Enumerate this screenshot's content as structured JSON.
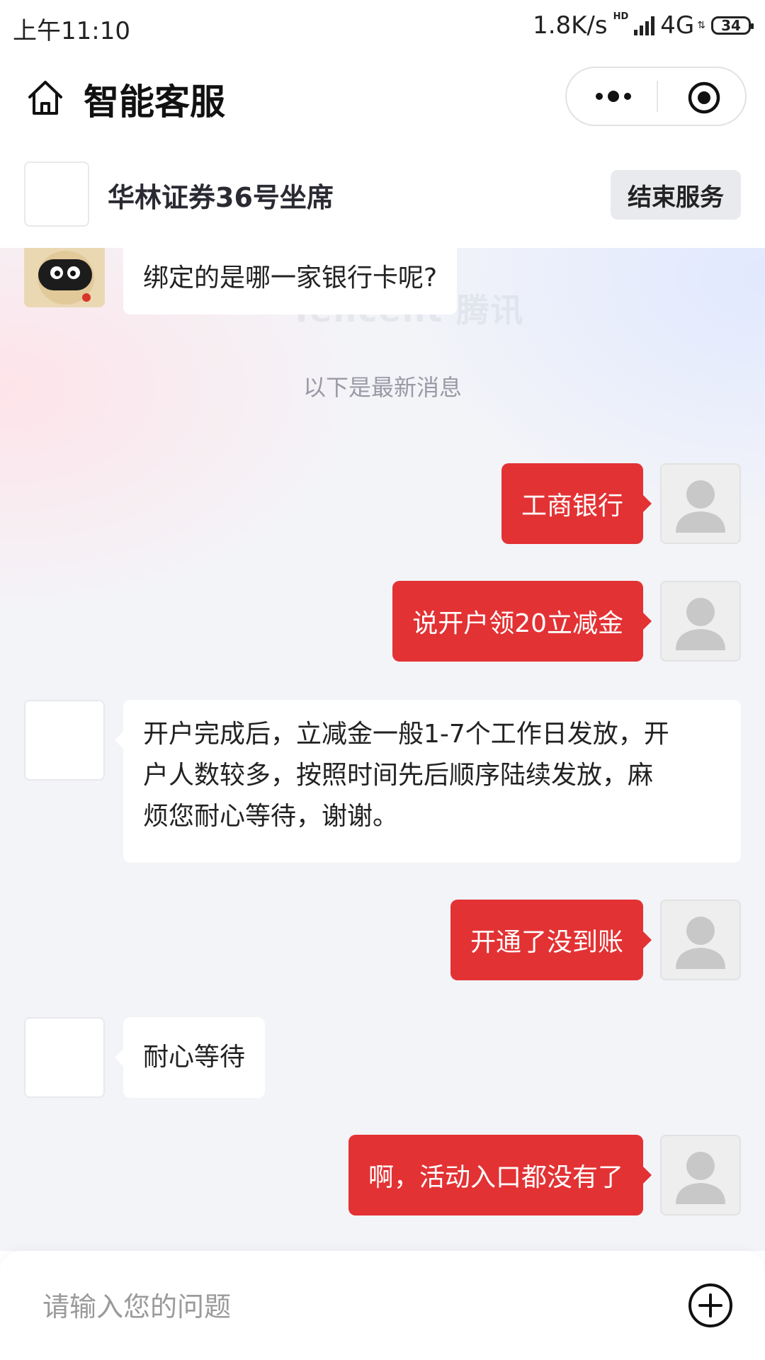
{
  "status_bar": {
    "time": "上午11:10",
    "net_speed": "1.8K/s",
    "hd": "HD",
    "network": "4G",
    "battery": "34"
  },
  "nav": {
    "title": "智能客服",
    "icons": [
      "home-icon",
      "more-icon",
      "target-icon"
    ]
  },
  "agent": {
    "name": "华林证券36号坐席",
    "end_button": "结束服务"
  },
  "chat": {
    "watermark": "Tencent 腾讯",
    "divider": "以下是最新消息",
    "messages": [
      {
        "side": "left",
        "avatar": "robot-avatar",
        "text": "绑定的是哪一家银行卡呢?"
      },
      {
        "side": "right",
        "text": "工商银行"
      },
      {
        "side": "right",
        "text": "说开户领20立减金"
      },
      {
        "side": "left",
        "text_lines": [
          "开户完成后，立减金一般1-7个工作日发放，开",
          "户人数较多，按照时间先后顺序陆续发放，麻",
          "烦您耐心等待，谢谢。"
        ]
      },
      {
        "side": "right",
        "text": "开通了没到账"
      },
      {
        "side": "left",
        "text": "耐心等待"
      },
      {
        "side": "right",
        "text": "啊，活动入口都没有了"
      }
    ]
  },
  "input": {
    "placeholder": "请输入您的问题",
    "value": ""
  },
  "colors": {
    "accent_red": "#e33234",
    "background": "#f3f4f8"
  }
}
